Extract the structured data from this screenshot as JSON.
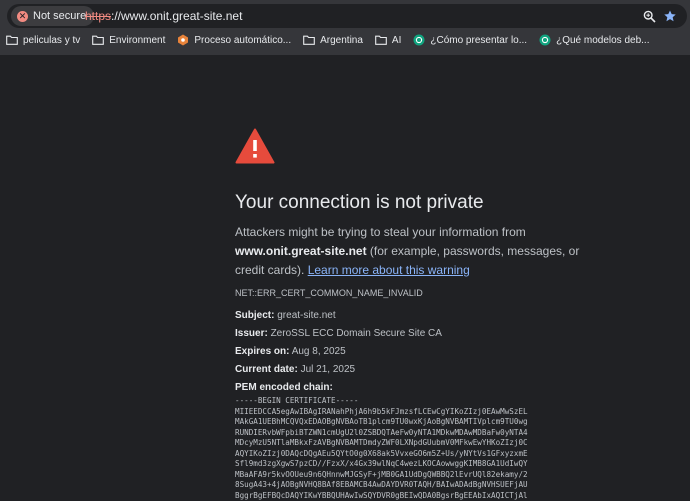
{
  "omnibox": {
    "security_label": "Not secure",
    "url_scheme": "https",
    "url_rest": "://www.onit.great-site.net",
    "zoom_icon": "zoom-icon",
    "bookmark_star_icon": "star-icon"
  },
  "bookmarks": [
    {
      "label": "peliculas y tv",
      "icon": "folder-icon"
    },
    {
      "label": "Environment",
      "icon": "folder-icon"
    },
    {
      "label": "Proceso automático...",
      "icon": "app-icon"
    },
    {
      "label": "Argentina",
      "icon": "folder-icon"
    },
    {
      "label": "AI",
      "icon": "folder-icon"
    },
    {
      "label": "¿Cómo presentar lo...",
      "icon": "chatgpt-icon"
    },
    {
      "label": "¿Qué modelos deb...",
      "icon": "chatgpt-icon"
    }
  ],
  "interstitial": {
    "heading": "Your connection is not private",
    "intro_before": "Attackers might be trying to steal your information from ",
    "host": "www.onit.great-site.net",
    "intro_after": " (for example, passwords, messages, or credit cards). ",
    "learn_more": "Learn more about this warning",
    "error_code": "NET::ERR_CERT_COMMON_NAME_INVALID",
    "details": [
      {
        "label": "Subject:",
        "value": "great-site.net"
      },
      {
        "label": "Issuer:",
        "value": "ZeroSSL ECC Domain Secure Site CA"
      },
      {
        "label": "Expires on:",
        "value": "Aug 8, 2025"
      },
      {
        "label": "Current date:",
        "value": "Jul 21, 2025"
      }
    ],
    "pem_label": "PEM encoded chain:",
    "pem_lines": [
      "-----BEGIN CERTIFICATE-----",
      "MIIEEDCCA5egAwIBAgIRANahPhjA6h9b5kFJmzsfLCEwCgYIKoZIzj0EAwMwSzEL",
      "MAkGA1UEBhMCQVQxEDAOBgNVBAoTB1plcm9TU0wxKjAoBgNVBAMTIVplcm9TU0wg",
      "RUNDIERvbWFpbiBTZWN1cmUgU2l0ZSBDQTAeFw0yNTA1MDkwMDAwMDBaFw0yNTA4",
      "MDcyMzU5NTlaMBkxFzAVBgNVBAMTDmdyZWF0LXNpdGUubmV0MFkwEwYHKoZIzj0C",
      "AQYIKoZIzj0DAQcDQgAEu5QYtO0g0X68ak5VvxeGO6m5Z+Us/yNYtVs1GFxyzxmE",
      "Sfl9md3zgXgwS7pzCD//FzxX/x4Gx39wlNqC4wezLKOCAowwggKIMB8GA1UdIwQY",
      "MBaAFA9r5kvOOUeu9n6QHnnwMJGSyF+jMB0GA1UdDgQWBBQ2lEvrUQl82ekamy/2",
      "8SugA43+4jAOBgNVHQ8BAf8EBAMCB4AwDAYDVR0TAQH/BAIwADAdBgNVHSUEFjAU",
      "BggrBgEFBQcDAQYIKwYBBQUHAwIwSQYDVR0gBEIwQDA0BgsrBgEEAbIxAQICTjAl"
    ]
  }
}
